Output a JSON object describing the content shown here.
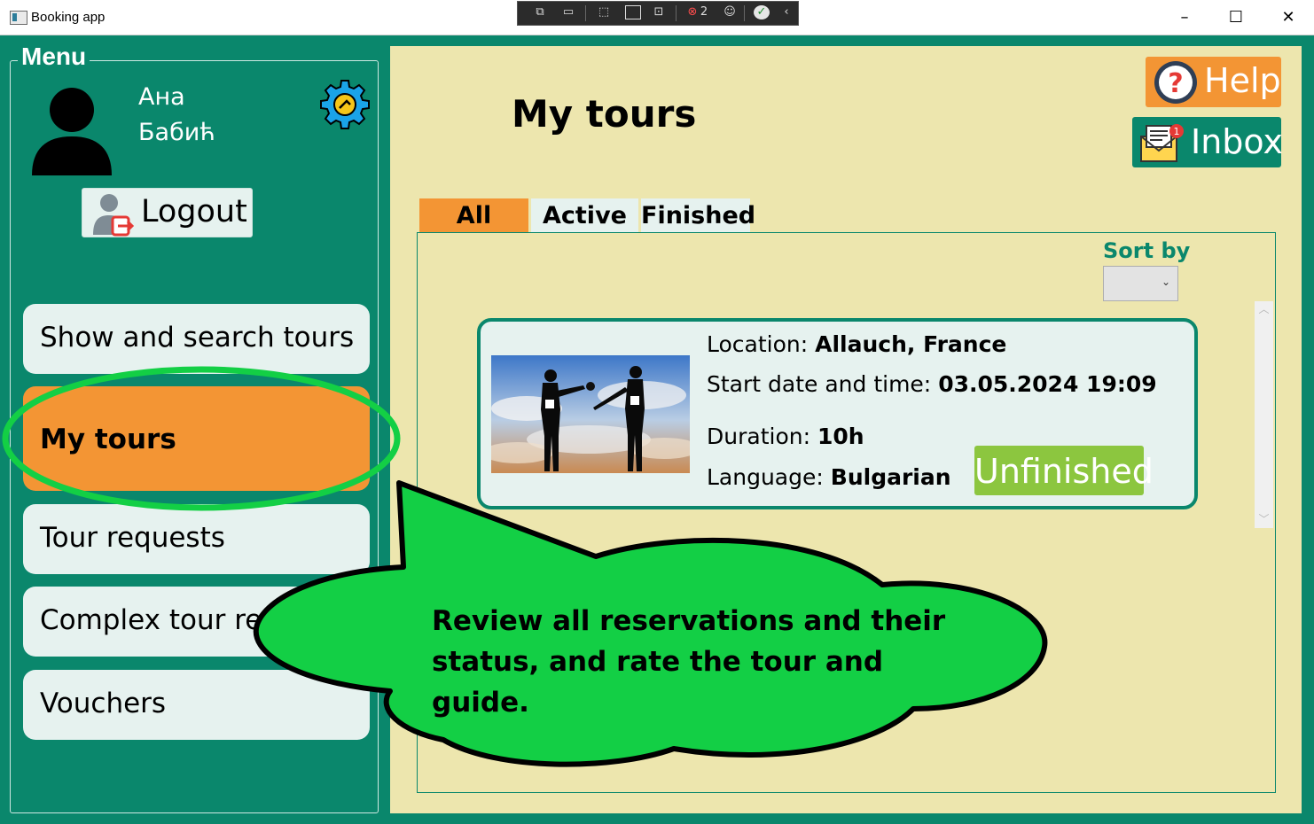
{
  "window": {
    "title": "Booking app",
    "minimize": "–",
    "maximize": "☐",
    "close": "✕"
  },
  "devtools": {
    "binding_errors": "2"
  },
  "menu": {
    "legend": "Menu",
    "user_first": "Ана",
    "user_last": "Бабић",
    "logout_label": "Logout",
    "items": [
      {
        "label": "Show and search tours",
        "icon": ""
      },
      {
        "label": "My tours",
        "active": true
      },
      {
        "label": "Tour requests"
      },
      {
        "label": "Complex tour requests"
      },
      {
        "label": "Vouchers"
      }
    ]
  },
  "header": {
    "page_title": "My tours",
    "help_label": "Help",
    "inbox_label": "Inbox",
    "inbox_badge": "1"
  },
  "tabs": [
    {
      "label": "All",
      "active": true
    },
    {
      "label": "Active"
    },
    {
      "label": "Finished"
    }
  ],
  "sort": {
    "label": "Sort by",
    "selected": ""
  },
  "tours": [
    {
      "location_label": "Location:",
      "location": "Allauch, France",
      "start_label": "Start date and time:",
      "start": "03.05.2024 19:09",
      "duration_label": "Duration:",
      "duration": "10h",
      "language_label": "Language:",
      "language": "Bulgarian",
      "status": "Unfinished"
    }
  ],
  "tooltip": {
    "line1": "Review all reservations and their",
    "line2": "status, and rate the tour and guide."
  },
  "colors": {
    "primary": "#0a876c",
    "accent": "#f39534",
    "panel": "#ede6ae",
    "card": "#e6f2ef",
    "status": "#8cc63f",
    "callout": "#13cf45"
  }
}
